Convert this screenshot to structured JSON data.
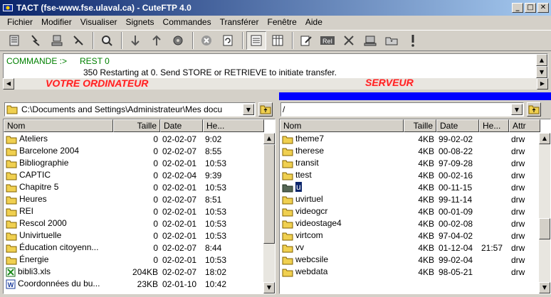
{
  "window": {
    "title": "TACT (fse-www.fse.ulaval.ca) - CuteFTP 4.0"
  },
  "menu": [
    "Fichier",
    "Modifier",
    "Visualiser",
    "Signets",
    "Commandes",
    "Transférer",
    "Fenêtre",
    "Aide"
  ],
  "log": {
    "line1_label": "COMMANDE :>",
    "line1_cmd": "REST 0",
    "line2": "350 Restarting at 0. Send STORE or RETRIEVE to initiate transfer."
  },
  "annotations": {
    "local": "VOTRE ORDINATEUR",
    "server": "SERVEUR"
  },
  "local": {
    "path": "C:\\Documents and Settings\\Administrateur\\Mes docu",
    "columns": [
      "Nom",
      "Taille",
      "Date",
      "He..."
    ],
    "rows": [
      {
        "name": "Ateliers",
        "size": "0",
        "date": "02-02-07",
        "time": "9:02",
        "icon": "folder"
      },
      {
        "name": "Barcelone 2004",
        "size": "0",
        "date": "02-02-07",
        "time": "8:55",
        "icon": "folder"
      },
      {
        "name": "Bibliographie",
        "size": "0",
        "date": "02-02-01",
        "time": "10:53",
        "icon": "folder"
      },
      {
        "name": "CAPTIC",
        "size": "0",
        "date": "02-02-04",
        "time": "9:39",
        "icon": "folder"
      },
      {
        "name": "Chapitre 5",
        "size": "0",
        "date": "02-02-01",
        "time": "10:53",
        "icon": "folder"
      },
      {
        "name": "Heures",
        "size": "0",
        "date": "02-02-07",
        "time": "8:51",
        "icon": "folder"
      },
      {
        "name": "REI",
        "size": "0",
        "date": "02-02-01",
        "time": "10:53",
        "icon": "folder"
      },
      {
        "name": "Rescol 2000",
        "size": "0",
        "date": "02-02-01",
        "time": "10:53",
        "icon": "folder"
      },
      {
        "name": "Univirtuelle",
        "size": "0",
        "date": "02-02-01",
        "time": "10:53",
        "icon": "folder"
      },
      {
        "name": "Éducation citoyenn...",
        "size": "0",
        "date": "02-02-07",
        "time": "8:44",
        "icon": "folder"
      },
      {
        "name": "Énergie",
        "size": "0",
        "date": "02-02-01",
        "time": "10:53",
        "icon": "folder"
      },
      {
        "name": "bibli3.xls",
        "size": "204KB",
        "date": "02-02-07",
        "time": "18:02",
        "icon": "excel"
      },
      {
        "name": "Coordonnées du bu...",
        "size": "23KB",
        "date": "02-01-10",
        "time": "10:42",
        "icon": "word"
      }
    ]
  },
  "remote": {
    "path": "/",
    "columns": [
      "Nom",
      "Taille",
      "Date",
      "He...",
      "Attr"
    ],
    "rows": [
      {
        "name": "theme7",
        "size": "4KB",
        "date": "99-02-02",
        "time": "",
        "attr": "drw",
        "icon": "folder"
      },
      {
        "name": "therese",
        "size": "4KB",
        "date": "00-08-22",
        "time": "",
        "attr": "drw",
        "icon": "folder"
      },
      {
        "name": "transit",
        "size": "4KB",
        "date": "97-09-28",
        "time": "",
        "attr": "drw",
        "icon": "folder"
      },
      {
        "name": "ttest",
        "size": "4KB",
        "date": "00-02-16",
        "time": "",
        "attr": "drw",
        "icon": "folder"
      },
      {
        "name": "u",
        "size": "4KB",
        "date": "00-11-15",
        "time": "",
        "attr": "drw",
        "icon": "folder-dark",
        "selected": true
      },
      {
        "name": "uvirtuel",
        "size": "4KB",
        "date": "99-11-14",
        "time": "",
        "attr": "drw",
        "icon": "folder"
      },
      {
        "name": "videogcr",
        "size": "4KB",
        "date": "00-01-09",
        "time": "",
        "attr": "drw",
        "icon": "folder"
      },
      {
        "name": "videostage4",
        "size": "4KB",
        "date": "00-02-08",
        "time": "",
        "attr": "drw",
        "icon": "folder"
      },
      {
        "name": "virtcom",
        "size": "4KB",
        "date": "97-04-02",
        "time": "",
        "attr": "drw",
        "icon": "folder"
      },
      {
        "name": "vv",
        "size": "4KB",
        "date": "01-12-04",
        "time": "21:57",
        "attr": "drw",
        "icon": "folder"
      },
      {
        "name": "webcsile",
        "size": "4KB",
        "date": "99-02-04",
        "time": "",
        "attr": "drw",
        "icon": "folder"
      },
      {
        "name": "webdata",
        "size": "4KB",
        "date": "98-05-21",
        "time": "",
        "attr": "drw",
        "icon": "folder"
      }
    ]
  },
  "colors": {
    "folder": "#f0d050",
    "selection": "#0a246a",
    "server_header": "#0000ff",
    "annotation": "#ff2020",
    "log_green": "#008000"
  }
}
